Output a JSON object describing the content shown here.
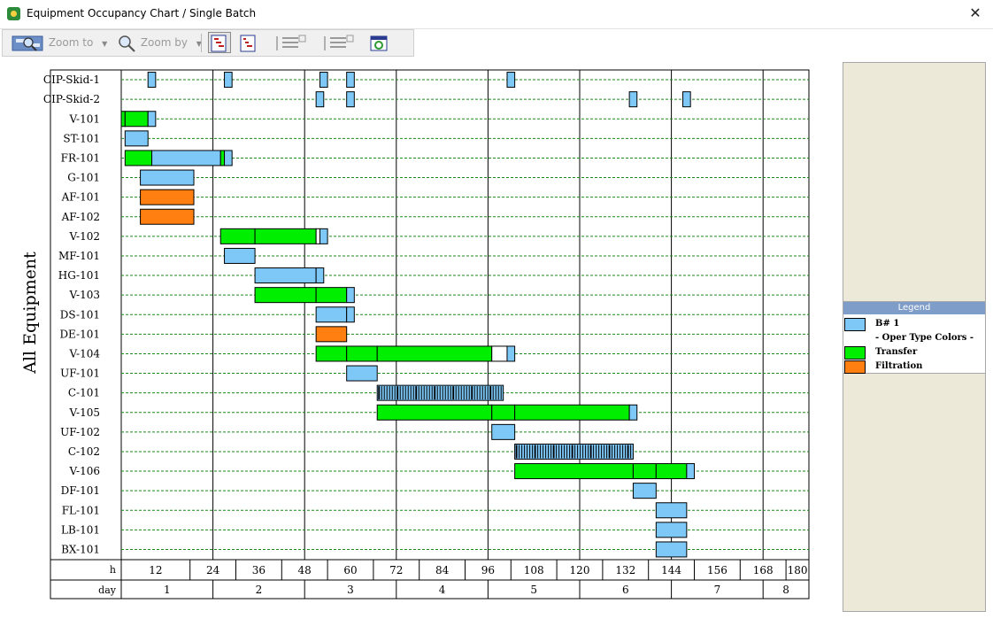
{
  "window": {
    "title": "Equipment Occupancy Chart / Single Batch",
    "close_glyph": "✕"
  },
  "toolbar": {
    "zoom_to": "Zoom to",
    "zoom_by": "Zoom by"
  },
  "chart": {
    "y_title": "All Equipment",
    "axis_h_label": "h",
    "axis_day_label": "day",
    "h_max": 180,
    "h_ticks": [
      12,
      24,
      36,
      48,
      60,
      72,
      84,
      96,
      108,
      120,
      132,
      144,
      156,
      168,
      180
    ],
    "days": [
      "1",
      "2",
      "3",
      "4",
      "5",
      "6",
      "7",
      "8"
    ],
    "colors": {
      "batch": "#7ec8f8",
      "transfer": "#00ee00",
      "filtration": "#ff7f10",
      "idle": "#ffffff"
    },
    "rows": [
      {
        "name": "CIP-Skid-1",
        "segs": [
          {
            "s": 7,
            "e": 9,
            "c": "batch"
          },
          {
            "s": 27,
            "e": 29,
            "c": "batch"
          },
          {
            "s": 52,
            "e": 54,
            "c": "batch"
          },
          {
            "s": 59,
            "e": 61,
            "c": "batch"
          },
          {
            "s": 101,
            "e": 103,
            "c": "batch"
          }
        ]
      },
      {
        "name": "CIP-Skid-2",
        "segs": [
          {
            "s": 51,
            "e": 53,
            "c": "batch"
          },
          {
            "s": 59,
            "e": 61,
            "c": "batch"
          },
          {
            "s": 133,
            "e": 135,
            "c": "batch"
          },
          {
            "s": 147,
            "e": 149,
            "c": "batch"
          }
        ]
      },
      {
        "name": "V-101",
        "segs": [
          {
            "s": 0,
            "e": 1,
            "c": "transfer"
          },
          {
            "s": 1,
            "e": 7,
            "c": "transfer"
          },
          {
            "s": 7,
            "e": 9,
            "c": "batch"
          }
        ]
      },
      {
        "name": "ST-101",
        "segs": [
          {
            "s": 1,
            "e": 7,
            "c": "batch"
          }
        ]
      },
      {
        "name": "FR-101",
        "segs": [
          {
            "s": 1,
            "e": 8,
            "c": "transfer"
          },
          {
            "s": 8,
            "e": 26,
            "c": "batch"
          },
          {
            "s": 26,
            "e": 27,
            "c": "transfer"
          },
          {
            "s": 27,
            "e": 29,
            "c": "batch"
          }
        ]
      },
      {
        "name": "G-101",
        "segs": [
          {
            "s": 5,
            "e": 19,
            "c": "batch"
          }
        ]
      },
      {
        "name": "AF-101",
        "segs": [
          {
            "s": 5,
            "e": 19,
            "c": "filtration"
          }
        ]
      },
      {
        "name": "AF-102",
        "segs": [
          {
            "s": 5,
            "e": 19,
            "c": "filtration"
          }
        ]
      },
      {
        "name": "V-102",
        "segs": [
          {
            "s": 26,
            "e": 35,
            "c": "transfer"
          },
          {
            "s": 35,
            "e": 51,
            "c": "transfer"
          },
          {
            "s": 51,
            "e": 52,
            "c": "idle"
          },
          {
            "s": 52,
            "e": 54,
            "c": "batch"
          }
        ]
      },
      {
        "name": "MF-101",
        "segs": [
          {
            "s": 27,
            "e": 35,
            "c": "batch"
          }
        ]
      },
      {
        "name": "HG-101",
        "segs": [
          {
            "s": 35,
            "e": 51,
            "c": "batch"
          },
          {
            "s": 51,
            "e": 53,
            "c": "batch"
          }
        ]
      },
      {
        "name": "V-103",
        "segs": [
          {
            "s": 35,
            "e": 51,
            "c": "transfer"
          },
          {
            "s": 51,
            "e": 59,
            "c": "transfer"
          },
          {
            "s": 59,
            "e": 61,
            "c": "batch"
          }
        ]
      },
      {
        "name": "DS-101",
        "segs": [
          {
            "s": 51,
            "e": 59,
            "c": "batch"
          },
          {
            "s": 59,
            "e": 61,
            "c": "batch"
          }
        ]
      },
      {
        "name": "DE-101",
        "segs": [
          {
            "s": 51,
            "e": 59,
            "c": "filtration"
          }
        ]
      },
      {
        "name": "V-104",
        "segs": [
          {
            "s": 51,
            "e": 59,
            "c": "transfer"
          },
          {
            "s": 59,
            "e": 67,
            "c": "transfer"
          },
          {
            "s": 67,
            "e": 97,
            "c": "transfer"
          },
          {
            "s": 97,
            "e": 101,
            "c": "idle"
          },
          {
            "s": 101,
            "e": 103,
            "c": "batch"
          }
        ]
      },
      {
        "name": "UF-101",
        "segs": [
          {
            "s": 59,
            "e": 67,
            "c": "batch"
          }
        ]
      },
      {
        "name": "C-101",
        "hatched": true,
        "segs": [
          {
            "s": 67,
            "e": 100,
            "c": "batch"
          }
        ]
      },
      {
        "name": "V-105",
        "segs": [
          {
            "s": 67,
            "e": 97,
            "c": "transfer"
          },
          {
            "s": 97,
            "e": 103,
            "c": "transfer"
          },
          {
            "s": 103,
            "e": 133,
            "c": "transfer"
          },
          {
            "s": 133,
            "e": 135,
            "c": "batch"
          }
        ]
      },
      {
        "name": "UF-102",
        "segs": [
          {
            "s": 97,
            "e": 103,
            "c": "batch"
          }
        ]
      },
      {
        "name": "C-102",
        "hatched": true,
        "segs": [
          {
            "s": 103,
            "e": 134,
            "c": "batch"
          }
        ]
      },
      {
        "name": "V-106",
        "segs": [
          {
            "s": 103,
            "e": 134,
            "c": "transfer"
          },
          {
            "s": 134,
            "e": 140,
            "c": "transfer"
          },
          {
            "s": 140,
            "e": 148,
            "c": "transfer"
          },
          {
            "s": 148,
            "e": 150,
            "c": "batch"
          }
        ]
      },
      {
        "name": "DF-101",
        "segs": [
          {
            "s": 134,
            "e": 140,
            "c": "batch"
          }
        ]
      },
      {
        "name": "FL-101",
        "segs": [
          {
            "s": 140,
            "e": 148,
            "c": "batch"
          }
        ]
      },
      {
        "name": "LB-101",
        "segs": [
          {
            "s": 140,
            "e": 148,
            "c": "batch"
          }
        ]
      },
      {
        "name": "BX-101",
        "segs": [
          {
            "s": 140,
            "e": 148,
            "c": "batch"
          }
        ]
      }
    ]
  },
  "legend": {
    "title": "Legend",
    "batch_label": "B# 1",
    "subheader": "- Oper Type Colors -",
    "items": [
      {
        "label": "Transfer",
        "color": "#00ee00"
      },
      {
        "label": "Filtration",
        "color": "#ff7f10"
      }
    ],
    "batch_color": "#7ec8f8"
  }
}
